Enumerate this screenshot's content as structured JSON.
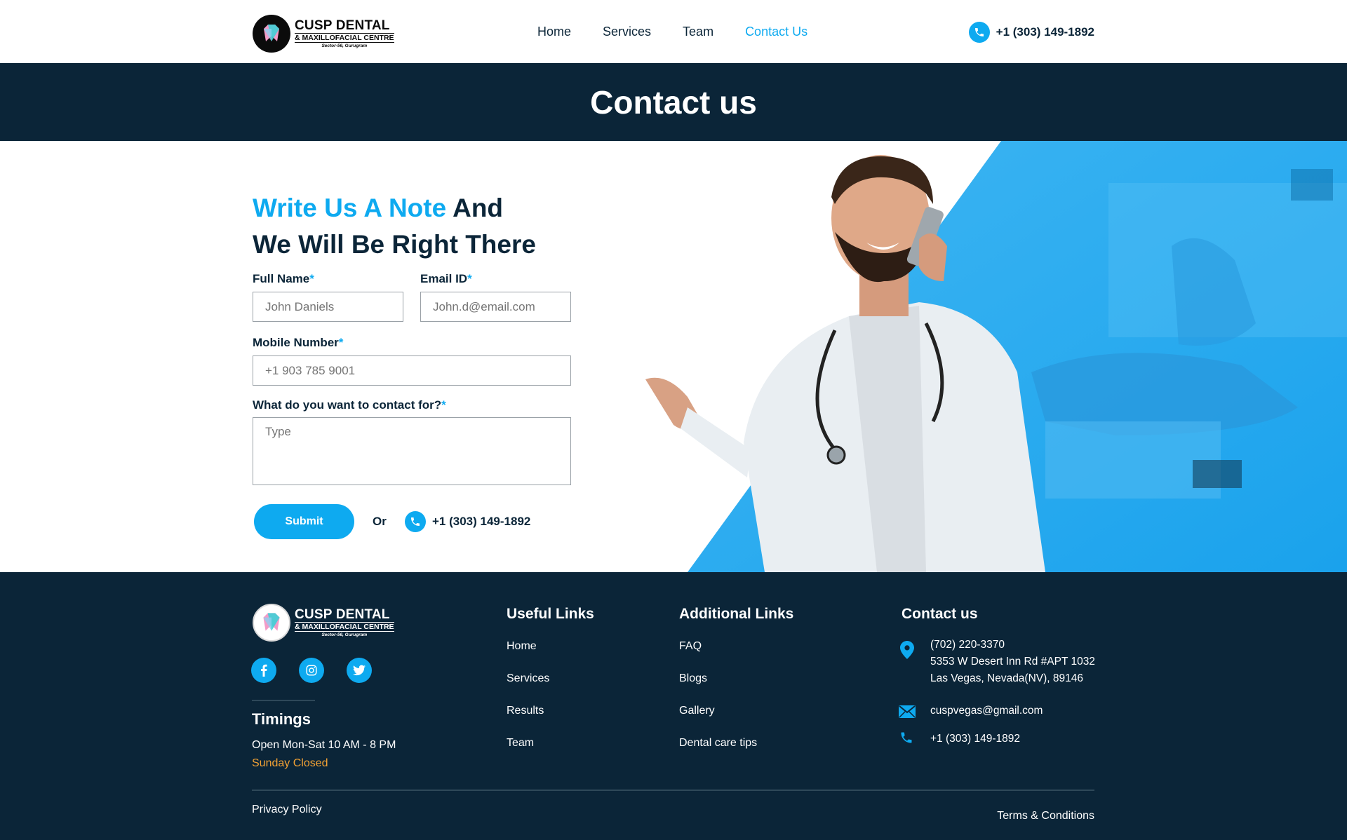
{
  "brand": {
    "name": "CUSP DENTAL",
    "subtitle": "& MAXILLOFACIAL CENTRE",
    "location": "Sector-56, Gurugram"
  },
  "nav": {
    "items": [
      "Home",
      "Services",
      "Team",
      "Contact Us"
    ],
    "active": "Contact Us"
  },
  "header": {
    "phone": "+1 (303) 149-1892"
  },
  "page": {
    "title": "Contact us"
  },
  "form": {
    "heading_highlight": "Write Us A Note",
    "heading_rest_1": "And",
    "heading_rest_2": "We Will Be Right There",
    "full_name_label": "Full Name",
    "full_name_placeholder": "John Daniels",
    "email_label": "Email ID",
    "email_placeholder": "John.d@email.com",
    "mobile_label": "Mobile Number",
    "mobile_placeholder": "+1 903 785 9001",
    "contact_for_label": "What do you want to contact for?",
    "contact_for_placeholder": "Type",
    "required_mark": "*",
    "submit_label": "Submit",
    "or_text": "Or",
    "phone": "+1 (303) 149-1892"
  },
  "footer": {
    "timings_title": "Timings",
    "timings_open": "Open Mon-Sat 10 AM - 8 PM",
    "timings_closed": "Sunday Closed",
    "useful_title": "Useful Links",
    "useful_links": [
      "Home",
      "Services",
      "Results",
      "Team"
    ],
    "additional_title": "Additional Links",
    "additional_links": [
      "FAQ",
      "Blogs",
      "Gallery",
      "Dental care tips"
    ],
    "contact_title": "Contact us",
    "address_phone": "(702) 220-3370",
    "address_line1": "5353 W Desert Inn Rd #APT 1032",
    "address_line2": "Las Vegas, Nevada(NV), 89146",
    "email": "cuspvegas@gmail.com",
    "phone": "+1 (303) 149-1892",
    "privacy": "Privacy Policy",
    "terms": "Terms & Conditions"
  },
  "colors": {
    "accent": "#0eaaf0",
    "navy": "#0b2538",
    "closed": "#f3a234"
  }
}
